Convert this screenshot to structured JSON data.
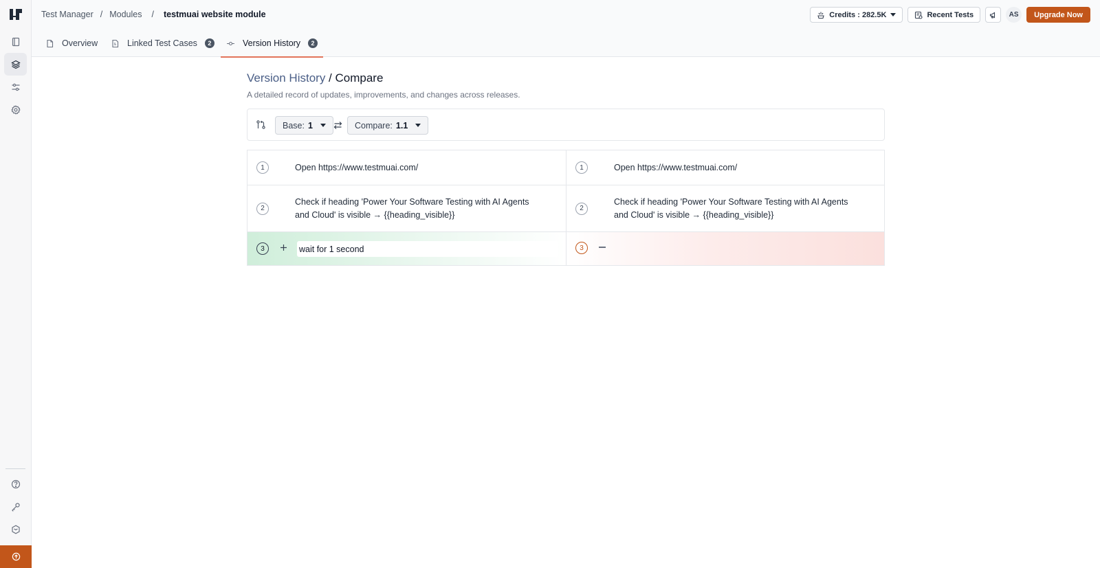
{
  "breadcrumbs": {
    "item1": "Test Manager",
    "item2": "Modules",
    "separator": "/",
    "current": "testmuai website module"
  },
  "topbar": {
    "credits_label": "Credits : 282.5K",
    "recent_tests_label": "Recent Tests",
    "avatar_initials": "AS",
    "upgrade_label": "Upgrade Now"
  },
  "tabs": [
    {
      "label": "Overview",
      "icon": "document-icon"
    },
    {
      "label": "Linked Test Cases",
      "count": "2",
      "icon": "linked-doc-icon"
    },
    {
      "label": "Version History",
      "count": "2",
      "icon": "commit-icon",
      "active": true
    }
  ],
  "page": {
    "title_link": "Version History",
    "title_rest": " / Compare",
    "subtitle": "A detailed record of updates, improvements, and changes across releases."
  },
  "compare": {
    "base_label": "Base:",
    "base_value": "1",
    "compare_label": "Compare:",
    "compare_value": "1.1"
  },
  "steps": [
    {
      "left_num": "1",
      "left_text": "Open https://www.testmuai.com/",
      "right_num": "1",
      "right_text": "Open https://www.testmuai.com/"
    },
    {
      "left_num": "2",
      "left_text": "Check if heading 'Power Your Software Testing with AI Agents and Cloud' is visible → {{heading_visible}}",
      "right_num": "2",
      "right_text": "Check if heading 'Power Your Software Testing with AI Agents and Cloud' is visible → {{heading_visible}}"
    },
    {
      "left_num": "3",
      "left_text": "wait for 1 second",
      "right_num": "3",
      "right_text": "",
      "status": "added"
    }
  ],
  "colors": {
    "accent": "#c2561a",
    "title_link": "#4a5e86",
    "added_bg": "#cfeeda",
    "removed_bg": "#fbe0dd"
  }
}
